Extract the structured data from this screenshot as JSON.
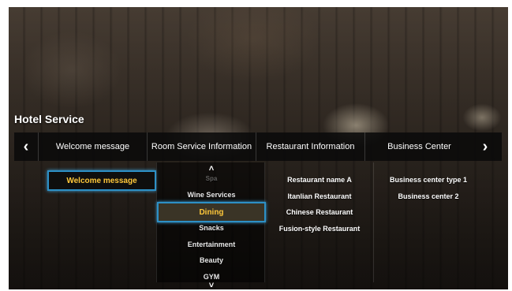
{
  "page": {
    "title": "Hotel Service"
  },
  "tabs": [
    {
      "label": "Welcome message"
    },
    {
      "label": "Room Service Information"
    },
    {
      "label": "Restaurant Information"
    },
    {
      "label": "Business Center"
    }
  ],
  "nav": {
    "prev_icon": "chevron-left-icon",
    "next_icon": "chevron-right-icon"
  },
  "welcome": {
    "focused_item": "Welcome message"
  },
  "room_service": {
    "items_above": [
      "Spa",
      "Wine Services"
    ],
    "selected": "Dining",
    "items_below": [
      "Snacks",
      "Entertainment",
      "Beauty",
      "GYM"
    ],
    "scroll_up_icon": "chevron-up-icon",
    "scroll_down_icon": "chevron-down-icon"
  },
  "restaurant": {
    "items": [
      "Restaurant name A",
      "Itanlian Restaurant",
      "Chinese Restaurant",
      "Fusion-style Restaurant"
    ]
  },
  "business": {
    "items": [
      "Business center type 1",
      "Business center 2"
    ]
  },
  "colors": {
    "focus_border": "#2d90c6",
    "selected_text": "#ffc83a",
    "bar_bg": "#0a0a0a"
  }
}
